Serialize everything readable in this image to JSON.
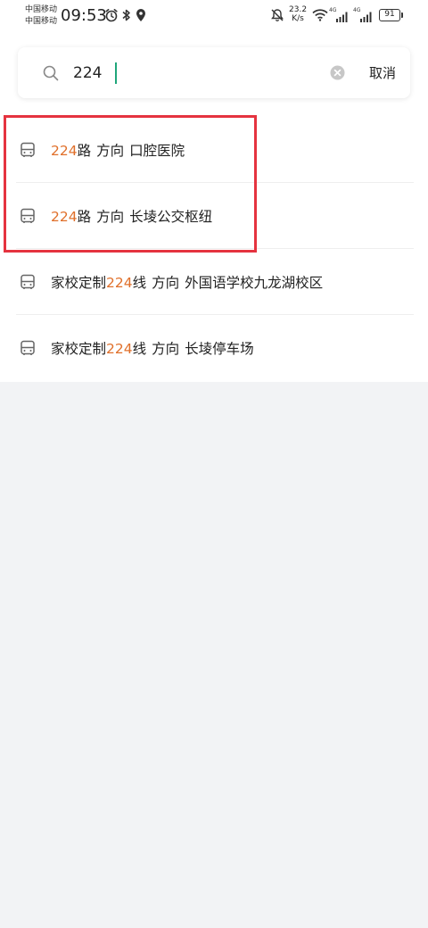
{
  "status_bar": {
    "carrier_1": "中国移动",
    "carrier_2": "中国移动",
    "time": "09:53",
    "net_speed_value": "23.2",
    "net_speed_unit": "K/s",
    "sim1_label": "4G",
    "sim2_label": "4G",
    "battery": "91"
  },
  "search": {
    "query": "224",
    "cancel_label": "取消"
  },
  "results": [
    {
      "prefix": "",
      "highlight": "224",
      "suffix": "路",
      "direction_word": "方向",
      "destination": "口腔医院"
    },
    {
      "prefix": "",
      "highlight": "224",
      "suffix": "路",
      "direction_word": "方向",
      "destination": "长堎公交枢纽"
    },
    {
      "prefix": "家校定制",
      "highlight": "224",
      "suffix": "线",
      "direction_word": "方向",
      "destination": "外国语学校九龙湖校区"
    },
    {
      "prefix": "家校定制",
      "highlight": "224",
      "suffix": "线",
      "direction_word": "方向",
      "destination": "长堎停车场"
    }
  ],
  "colors": {
    "highlight": "#e0702b",
    "annotation_box": "#e5333f",
    "caret": "#1fa67a"
  },
  "icons": {
    "result_item": "bus-icon",
    "search": "search-icon",
    "clear": "clear-icon"
  }
}
